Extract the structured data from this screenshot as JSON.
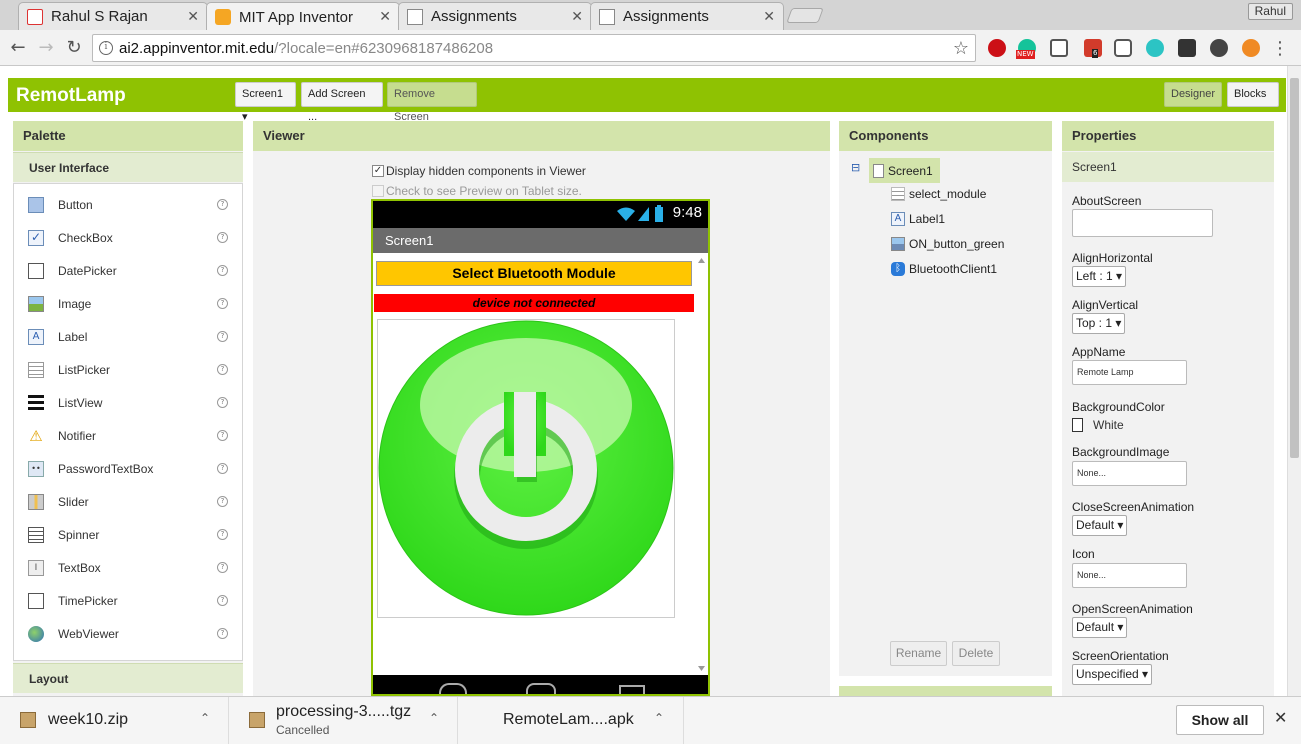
{
  "browser": {
    "tabs": [
      {
        "label": "Rahul S Rajan",
        "favicon": "gmail-icon"
      },
      {
        "label": "MIT App Inventor",
        "favicon": "app-inventor-icon"
      },
      {
        "label": "Assignments",
        "favicon": "document-icon"
      },
      {
        "label": "Assignments",
        "favicon": "document-icon"
      }
    ],
    "active_tab": 1,
    "profile_name": "Rahul",
    "url_host": "ai2.appinventor.mit.edu",
    "url_path": "/?locale=en#6230968187486208",
    "extension_badges": {
      "new": "NEW",
      "count": "6"
    }
  },
  "app": {
    "project_name": "RemotLamp",
    "screen_select": "Screen1 ▾",
    "add_screen": "Add Screen ...",
    "remove_screen": "Remove Screen",
    "designer": "Designer",
    "blocks": "Blocks",
    "accent_color": "#8fc202"
  },
  "palette": {
    "title": "Palette",
    "category": "User Interface",
    "items": [
      {
        "label": "Button",
        "icon": "button-icon"
      },
      {
        "label": "CheckBox",
        "icon": "checkbox-icon"
      },
      {
        "label": "DatePicker",
        "icon": "datepicker-icon"
      },
      {
        "label": "Image",
        "icon": "image-icon"
      },
      {
        "label": "Label",
        "icon": "label-icon"
      },
      {
        "label": "ListPicker",
        "icon": "listpicker-icon"
      },
      {
        "label": "ListView",
        "icon": "listview-icon"
      },
      {
        "label": "Notifier",
        "icon": "notifier-icon"
      },
      {
        "label": "PasswordTextBox",
        "icon": "password-icon"
      },
      {
        "label": "Slider",
        "icon": "slider-icon"
      },
      {
        "label": "Spinner",
        "icon": "spinner-icon"
      },
      {
        "label": "TextBox",
        "icon": "textbox-icon"
      },
      {
        "label": "TimePicker",
        "icon": "timepicker-icon"
      },
      {
        "label": "WebViewer",
        "icon": "webviewer-icon"
      }
    ],
    "help_glyph": "?",
    "next_category": "Layout"
  },
  "viewer": {
    "title": "Viewer",
    "display_hidden": "Display hidden components in Viewer",
    "tablet_preview": "Check to see Preview on Tablet size.",
    "phone": {
      "time": "9:48",
      "screen_title": "Screen1",
      "button_text": "Select Bluetooth Module",
      "status_text": "device not connected",
      "button_color": "#ffc600",
      "status_color": "#ff0000",
      "power_color": "#36e01f"
    }
  },
  "components": {
    "title": "Components",
    "root": "Screen1",
    "toggle": "⊟",
    "children": [
      {
        "label": "select_module",
        "icon": "button-icon"
      },
      {
        "label": "Label1",
        "icon": "label-icon"
      },
      {
        "label": "ON_button_green",
        "icon": "image-icon"
      },
      {
        "label": "BluetoothClient1",
        "icon": "bluetooth-icon"
      }
    ],
    "rename": "Rename",
    "delete": "Delete"
  },
  "properties": {
    "title": "Properties",
    "component": "Screen1",
    "about_screen": {
      "label": "AboutScreen",
      "value": ""
    },
    "align_horizontal": {
      "label": "AlignHorizontal",
      "value": "Left : 1 ▾"
    },
    "align_vertical": {
      "label": "AlignVertical",
      "value": "Top : 1 ▾"
    },
    "app_name": {
      "label": "AppName",
      "value": "Remote Lamp"
    },
    "background_color": {
      "label": "BackgroundColor",
      "value": "White"
    },
    "background_image": {
      "label": "BackgroundImage",
      "value": "None..."
    },
    "close_animation": {
      "label": "CloseScreenAnimation",
      "value": "Default ▾"
    },
    "icon": {
      "label": "Icon",
      "value": "None..."
    },
    "open_animation": {
      "label": "OpenScreenAnimation",
      "value": "Default ▾"
    },
    "orientation": {
      "label": "ScreenOrientation",
      "value": "Unspecified ▾"
    }
  },
  "downloads": {
    "items": [
      {
        "name": "week10.zip",
        "status": ""
      },
      {
        "name": "processing-3.....tgz",
        "status": "Cancelled"
      },
      {
        "name": "RemoteLam....apk",
        "status": ""
      }
    ],
    "chevron": "⌃",
    "show_all": "Show all",
    "close": "✕"
  }
}
